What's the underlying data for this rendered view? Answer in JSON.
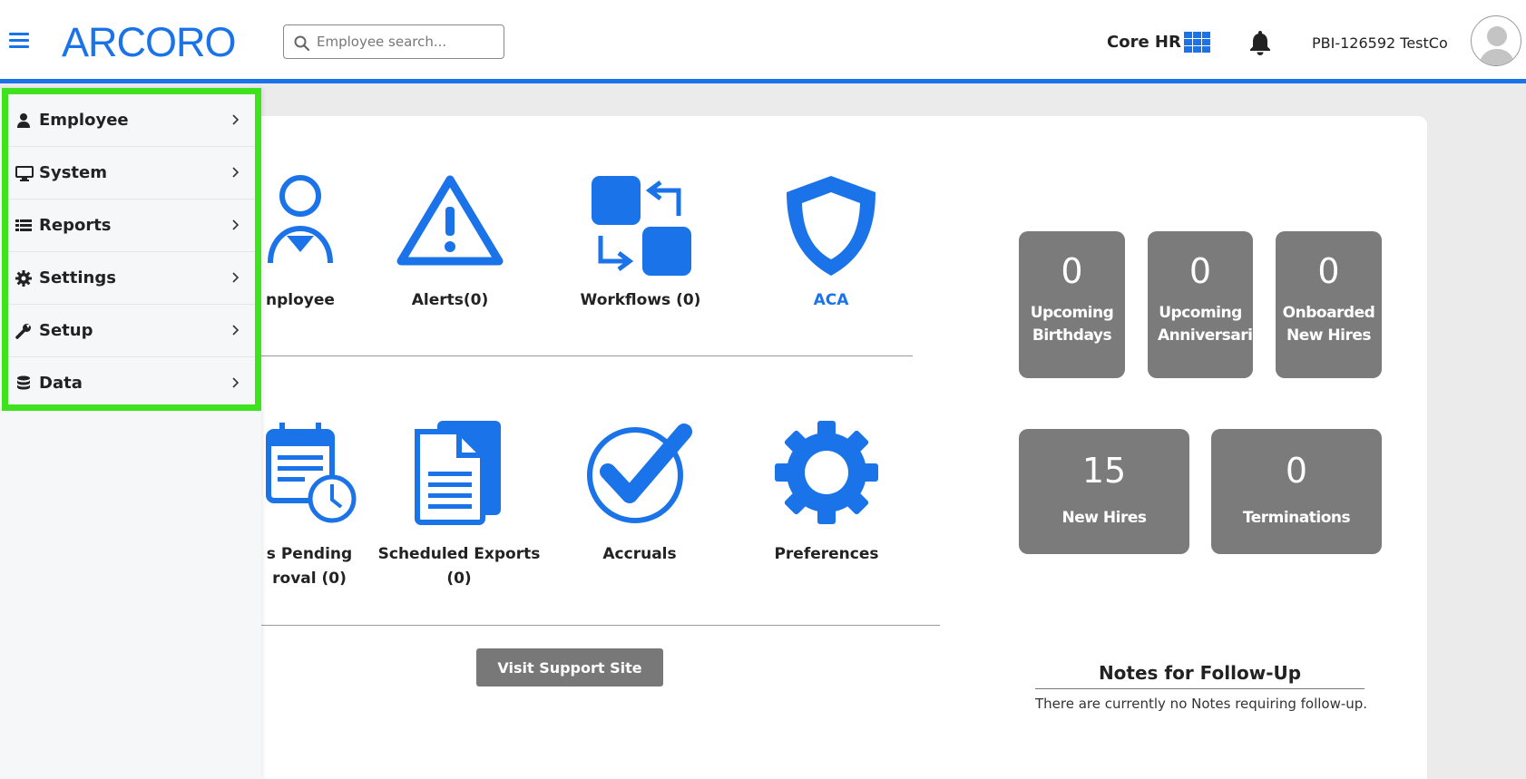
{
  "header": {
    "logo": "ARCORO",
    "search_placeholder": "Employee search...",
    "product": "Core HR",
    "company": "PBI-126592 TestCo"
  },
  "sidebar": {
    "items": [
      {
        "label": "Employee",
        "icon": "user-icon"
      },
      {
        "label": "System",
        "icon": "monitor-icon"
      },
      {
        "label": "Reports",
        "icon": "list-icon"
      },
      {
        "label": "Settings",
        "icon": "gear-icon"
      },
      {
        "label": "Setup",
        "icon": "wrench-icon"
      },
      {
        "label": "Data",
        "icon": "database-icon"
      }
    ]
  },
  "dashboard": {
    "row1": [
      {
        "label": "nployee",
        "icon": "employee-icon"
      },
      {
        "label": "Alerts(0)",
        "icon": "warning-icon"
      },
      {
        "label": "Workflows (0)",
        "icon": "workflow-icon"
      },
      {
        "label": "ACA",
        "icon": "shield-icon"
      }
    ],
    "row2": [
      {
        "label1": "s Pending",
        "label2": "roval (0)",
        "icon": "calendar-clock-icon"
      },
      {
        "label1": "Scheduled Exports",
        "label2": "(0)",
        "icon": "document-icon"
      },
      {
        "label1": "Accruals",
        "label2": "",
        "icon": "checkmark-icon"
      },
      {
        "label1": "Preferences",
        "label2": "",
        "icon": "gear-icon"
      }
    ],
    "support_button": "Visit Support Site"
  },
  "stats": [
    {
      "value": "0",
      "line1": "Upcoming",
      "line2": "Birthdays"
    },
    {
      "value": "0",
      "line1": "Upcoming",
      "line2": "Anniversaries"
    },
    {
      "value": "0",
      "line1": "Onboarded",
      "line2": "New Hires"
    },
    {
      "value": "15",
      "line1": "New Hires",
      "line2": ""
    },
    {
      "value": "0",
      "line1": "Terminations",
      "line2": ""
    }
  ],
  "notes": {
    "title": "Notes for Follow-Up",
    "text": "There are currently no Notes requiring follow-up."
  },
  "colors": {
    "accent": "#1a73e8",
    "stat_bg": "#7b7b7b",
    "highlight": "#3ee31e"
  }
}
